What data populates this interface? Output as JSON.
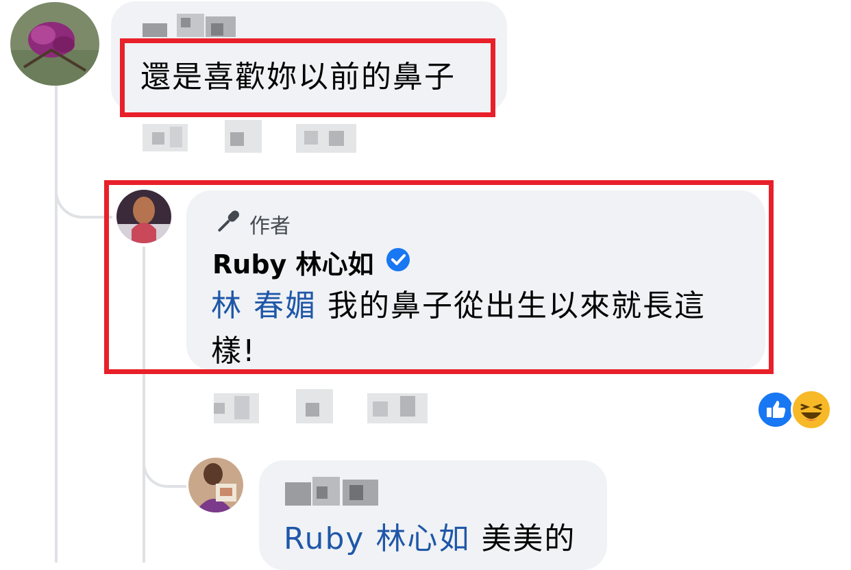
{
  "comment_1": {
    "author_name_hidden": true,
    "text": "還是喜歡妳以前的鼻子"
  },
  "reply_1": {
    "badge_label": "作者",
    "author_name": "Ruby 林心如",
    "mention": "林 春媚",
    "text_line1": "我的鼻子從出生以來就長這",
    "text_line2": "樣!"
  },
  "reply_2": {
    "mention": "Ruby 林心如",
    "text": "美美的"
  },
  "reactions": [
    "like-icon",
    "haha-icon"
  ],
  "colors": {
    "highlight": "#e8202a",
    "bubble_bg": "#f0f2f5",
    "mention": "#1f57a8",
    "verified": "#1877f2"
  }
}
